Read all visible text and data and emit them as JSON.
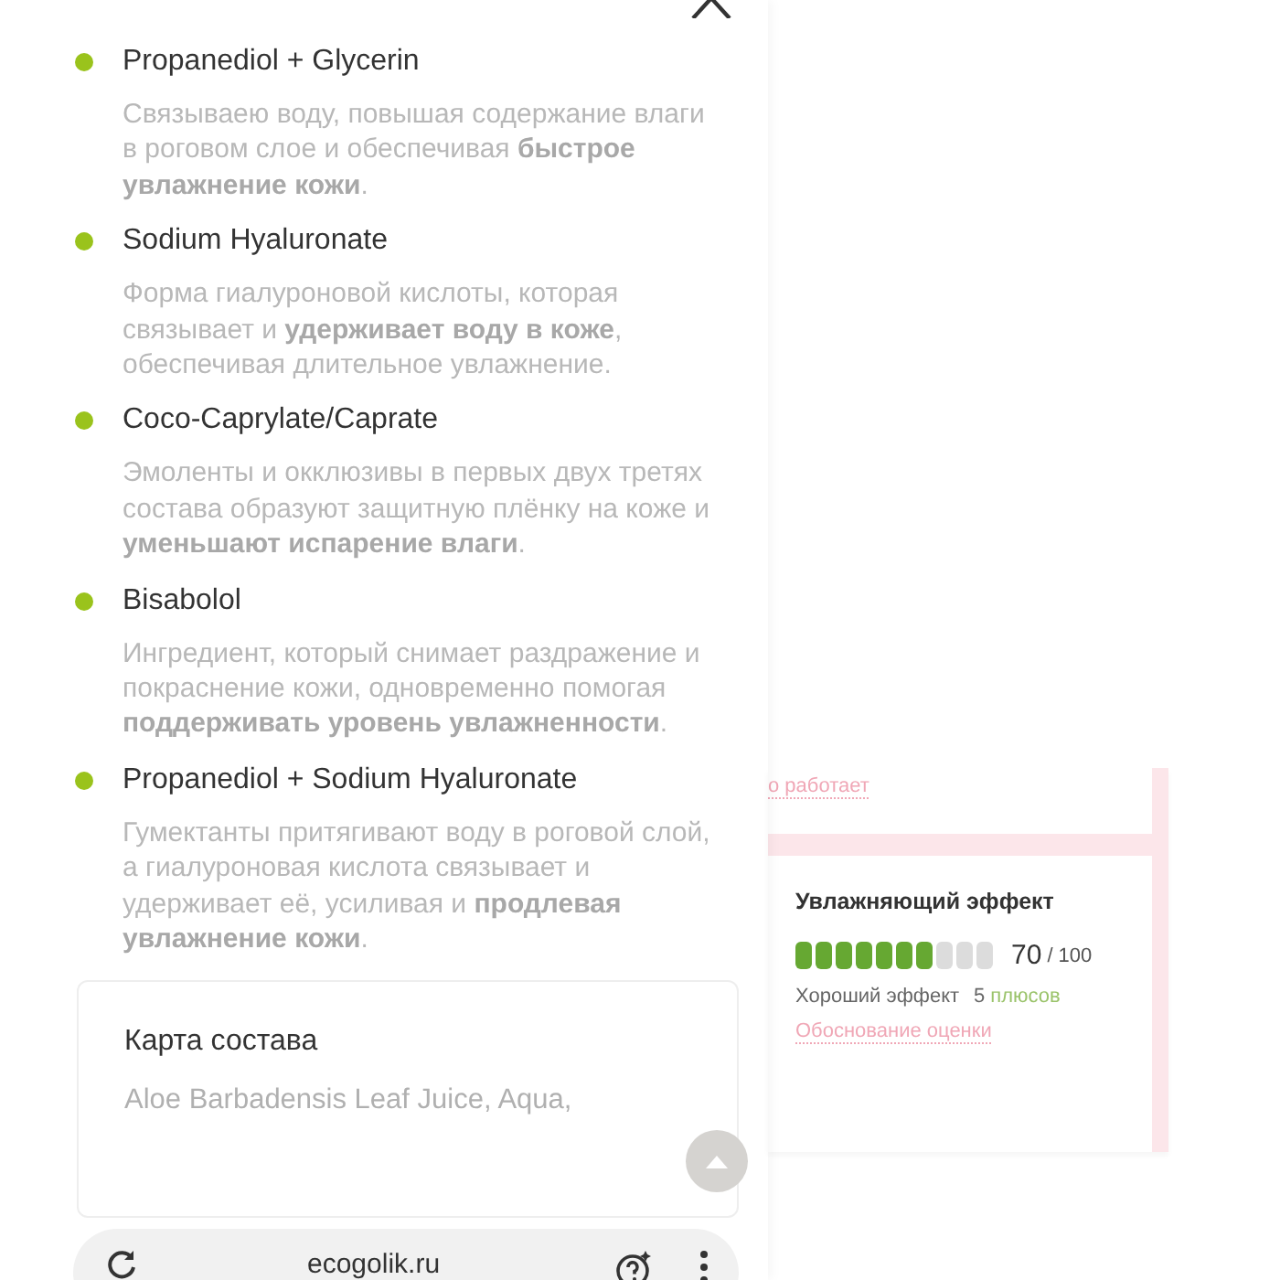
{
  "ingredients": [
    {
      "name": "Propanediol + Glycerin",
      "description": "Связываею воду, повышая содержание влаги в роговом слое и обеспечивая **быстрое увлажнение кожи**."
    },
    {
      "name": "Sodium Hyaluronate",
      "description": "Форма гиалуроновой кислоты, которая связывает и **удерживает воду в коже**, обеспечивая длительное увлажнение."
    },
    {
      "name": "Coco-Caprylate/Caprate",
      "description": "Эмоленты и окклюзивы в первых двух третях состава образуют защитную плёнку на коже и **уменьшают испарение влаги**."
    },
    {
      "name": "Bisabolol",
      "description": "Ингредиент, который снимает раздражение и покраснение кожи, одновременно помогая **поддерживать уровень увлажненности**."
    },
    {
      "name": "Propanediol + Sodium Hyaluronate",
      "description": "Гумектанты притягивают воду в роговой слой, а гиалуроновая кислота связывает и удерживает её, усиливая и **продлевая увлажнение кожи**."
    }
  ],
  "composition_card": {
    "title": "Карта состава",
    "text": "Aloe Barbadensis Leaf Juice, Aqua,"
  },
  "rating": {
    "top_link": "о работает",
    "title": "Увлажняющий эффект",
    "level": 0.7,
    "score": "70",
    "max": "/ 100",
    "verdict": "Хороший эффект",
    "pluses_count": "5",
    "pluses_label": "плюсов",
    "link": "Обоснование оценки"
  },
  "browser": {
    "url": "ecogolik.ru"
  }
}
